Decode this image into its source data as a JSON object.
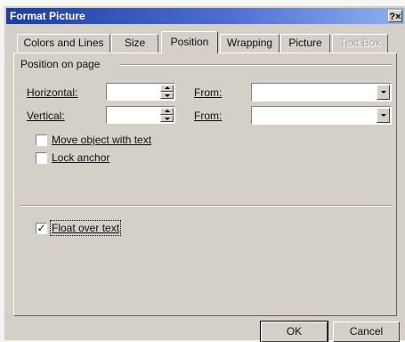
{
  "dialog": {
    "title": "Format Picture",
    "help_label": "?×"
  },
  "tabs": [
    {
      "label": "Colors and Lines"
    },
    {
      "label": "Size"
    },
    {
      "label": "Position"
    },
    {
      "label": "Wrapping"
    },
    {
      "label": "Picture"
    },
    {
      "label": "Text Box"
    }
  ],
  "position_group": {
    "title": "Position on page",
    "horizontal_label": "Horizontal:",
    "horizontal_value": "",
    "vertical_label": "Vertical:",
    "vertical_value": "",
    "from_label_1": "From:",
    "from_value_1": "",
    "from_label_2": "From:",
    "from_value_2": ""
  },
  "options": {
    "move_with_text": {
      "label": "Move object with text",
      "checked": false
    },
    "lock_anchor": {
      "label": "Lock anchor",
      "checked": false
    },
    "float_over_text": {
      "label": "Float over text",
      "checked": true
    },
    "check_mark": "✓"
  },
  "buttons": {
    "ok": "OK",
    "cancel": "Cancel"
  }
}
